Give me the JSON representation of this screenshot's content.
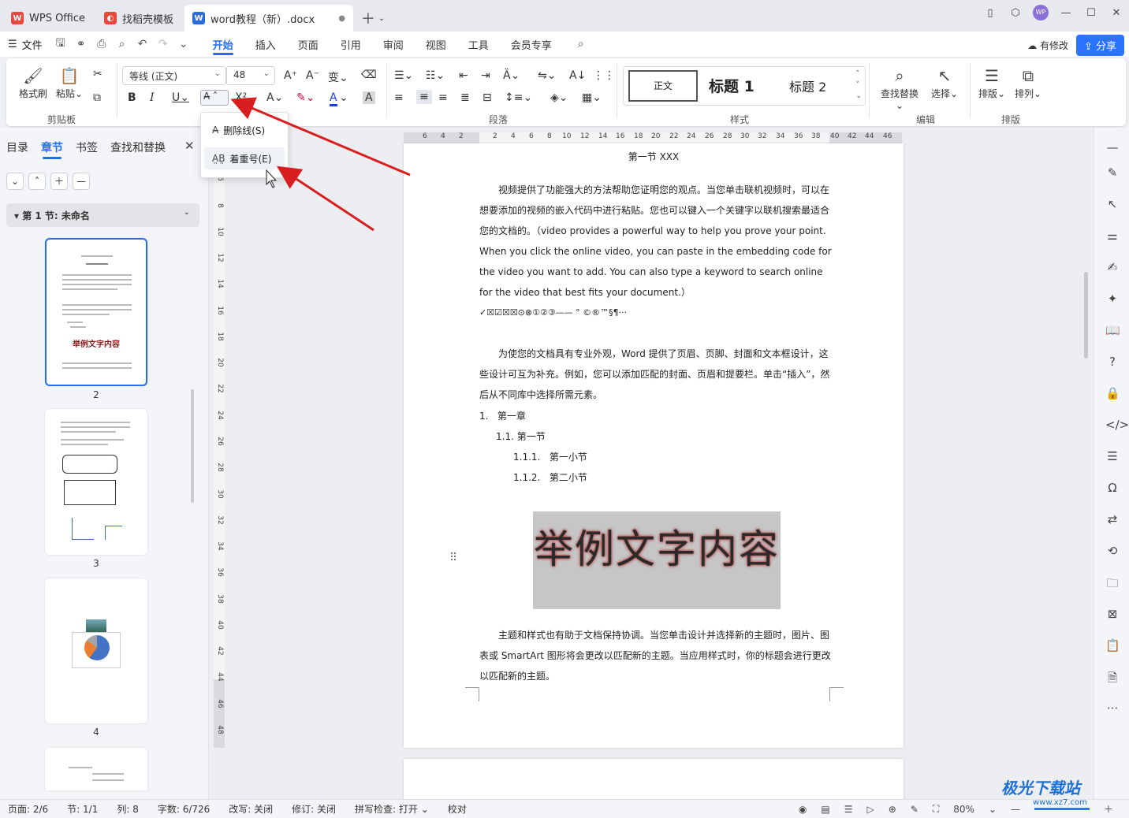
{
  "titlebar": {
    "tabs": [
      {
        "label": "WPS Office",
        "icon": "wps-logo-icon",
        "color": "#e8473d"
      },
      {
        "label": "找稻壳模板",
        "icon": "docer-icon",
        "color": "#e8473d"
      },
      {
        "label": "word教程（新）.docx",
        "icon": "word-doc-icon",
        "color": "#2a6ae0"
      }
    ],
    "avatar": "WP"
  },
  "menubar": {
    "file": "文件",
    "items": [
      "开始",
      "插入",
      "页面",
      "引用",
      "审阅",
      "视图",
      "工具",
      "会员专享"
    ],
    "active": "开始",
    "modified": "有修改",
    "share": "分享"
  },
  "ribbon": {
    "format_painter": "格式刷",
    "paste": "粘贴",
    "clipboard_group": "剪贴板",
    "font_name": "等线 (正文)",
    "font_size": "48",
    "paragraph_group": "段落",
    "styles": {
      "normal": "正文",
      "h1": "标题 1",
      "h2": "标题 2",
      "group": "样式"
    },
    "find_replace": "查找替换",
    "select": "选择",
    "edit_group": "编辑",
    "layout": "排版",
    "arrange": "排列",
    "layout_group": "排版"
  },
  "popup": {
    "items": [
      {
        "label": "删除线(S)",
        "icon": "strikethrough-icon"
      },
      {
        "label": "着重号(E)",
        "icon": "emphasis-mark-icon"
      }
    ]
  },
  "leftpanel": {
    "tabs": [
      "目录",
      "章节",
      "书签",
      "查找和替换"
    ],
    "active": "章节",
    "section": "第 1 节: 未命名",
    "thumb_title": "举例文字内容",
    "pages": [
      "2",
      "3",
      "4"
    ]
  },
  "ruler": {
    "h": [
      "6",
      "4",
      "2",
      "2",
      "4",
      "6",
      "8",
      "10",
      "12",
      "14",
      "16",
      "18",
      "20",
      "22",
      "24",
      "26",
      "28",
      "30",
      "32",
      "34",
      "36",
      "38",
      "40",
      "42",
      "44",
      "46"
    ],
    "v": [
      "6",
      "8",
      "10",
      "12",
      "14",
      "16",
      "18",
      "20",
      "22",
      "24",
      "26",
      "28",
      "30",
      "32",
      "34",
      "36",
      "38",
      "40",
      "42",
      "44",
      "46",
      "48"
    ]
  },
  "document": {
    "heading": "第一节  XXX",
    "para1": "视频提供了功能强大的方法帮助您证明您的观点。当您单击联机视频时，可以在想要添加的视频的嵌入代码中进行粘贴。您也可以键入一个关键字以联机搜索最适合您的文档的。（video provides a powerful way to help you prove your point. When you click the online video, you can paste in the embedding code for the video you want to add. You can also type a keyword to search online for the video that best fits your document.）",
    "symbols": "✓☒☑☒☒⊙⊗①②③——    °  ©®™§¶···",
    "para2": "为使您的文档具有专业外观，Word 提供了页眉、页脚、封面和文本框设计，这些设计可互为补充。例如，您可以添加匹配的封面、页眉和提要栏。单击“插入”，然后从不同库中选择所需元素。",
    "list": [
      {
        "num": "1.",
        "text": "第一章"
      },
      {
        "num": "1.1.",
        "text": "第一节"
      },
      {
        "num": "1.1.1.",
        "text": "第一小节"
      },
      {
        "num": "1.1.2.",
        "text": "第二小节"
      }
    ],
    "wordart": "举例文字内容",
    "para3": "主题和样式也有助于文档保持协调。当您单击设计并选择新的主题时，图片、图表或 SmartArt 图形将会更改以匹配新的主题。当应用样式时，你的标题会进行更改以匹配新的主题。"
  },
  "statusbar": {
    "page": "页面: 2/6",
    "section": "节: 1/1",
    "col": "列: 8",
    "words": "字数: 6/726",
    "rewrite": "改写: 关闭",
    "revise": "修订: 关闭",
    "spell": "拼写检查: 打开",
    "proof": "校对",
    "zoom": "80%"
  },
  "watermark": {
    "title": "极光下载站",
    "url": "www.xz7.com"
  },
  "colors": {
    "accent": "#1e6fff",
    "arrow": "#d81e1e"
  }
}
